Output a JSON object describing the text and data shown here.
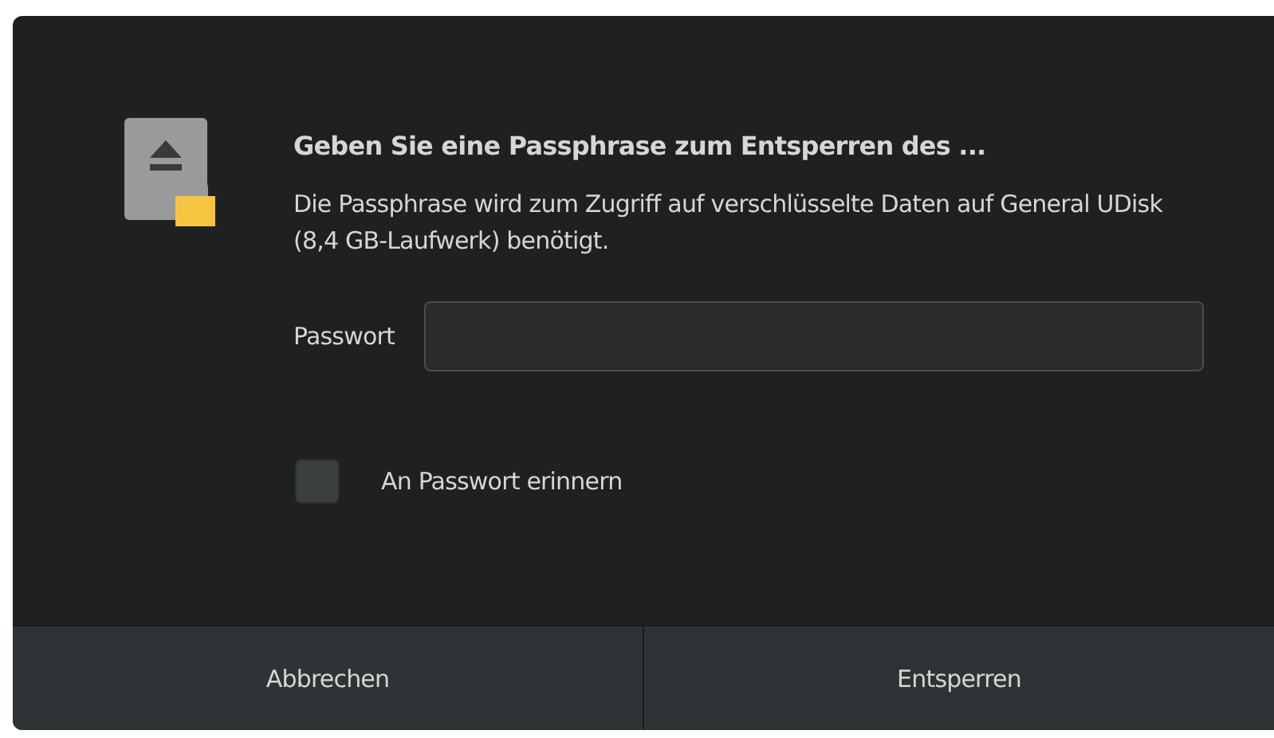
{
  "dialog": {
    "title": "Geben Sie eine Passphrase zum Entsperren des ...",
    "message": "Die Passphrase wird zum Zugriff auf verschlüsselte Daten auf General UDisk (8,4 GB-Laufwerk) benötigt.",
    "password": {
      "label": "Passwort"
    },
    "remember": {
      "label": "An Passwort erinnern",
      "checked": false
    },
    "buttons": [
      "Abbrechen",
      "Entsperren"
    ]
  }
}
